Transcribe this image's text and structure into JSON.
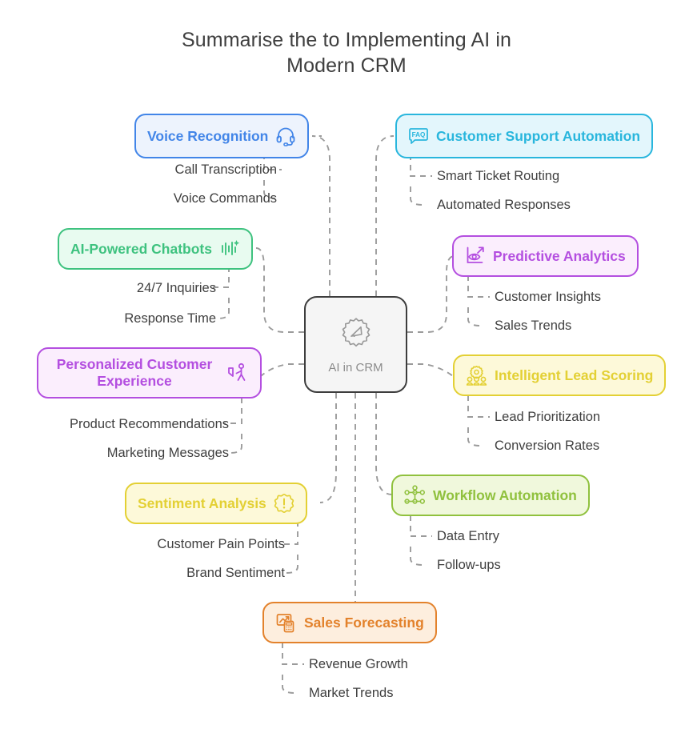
{
  "title": "Summarise the to Implementing AI in\nModern CRM",
  "title_line1": "Summarise the to Implementing AI in",
  "title_line2": "Modern CRM",
  "center": {
    "label": "AI in CRM",
    "icon": "ai-badge-icon",
    "border_color": "#3d3d3d",
    "fill_color": "#f5f5f5",
    "text_color": "#8c8c8c"
  },
  "connector": {
    "color": "#9b9b9b",
    "style": "dashed"
  },
  "branches": [
    {
      "id": "voice-recognition",
      "label": "Voice Recognition",
      "icon": "headset-icon",
      "color": "#4285e8",
      "fill": "#edf3fd",
      "side": "left",
      "children": [
        "Call Transcription",
        "Voice Commands"
      ]
    },
    {
      "id": "customer-support-automation",
      "label": "Customer Support Automation",
      "icon": "faq-bubble-icon",
      "color": "#29b6dd",
      "fill": "#e3f6fc",
      "side": "right",
      "children": [
        "Smart Ticket Routing",
        "Automated Responses"
      ]
    },
    {
      "id": "ai-powered-chatbots",
      "label": "AI-Powered Chatbots",
      "icon": "sound-wave-sparkle-icon",
      "color": "#3ec27f",
      "fill": "#e8fbf0",
      "side": "left",
      "children": [
        "24/7 Inquiries",
        "Response Time"
      ]
    },
    {
      "id": "predictive-analytics",
      "label": "Predictive Analytics",
      "icon": "eye-growth-chart-icon",
      "color": "#b44fe0",
      "fill": "#fbeefd",
      "side": "right",
      "children": [
        "Customer Insights",
        "Sales Trends"
      ]
    },
    {
      "id": "personalized-customer-experience",
      "label_line1": "Personalized Customer",
      "label_line2": "Experience",
      "label": "Personalized Customer Experience",
      "icon": "person-touch-icon",
      "color": "#b44fe0",
      "fill": "#fbeefd",
      "side": "left",
      "children": [
        "Product Recommendations",
        "Marketing Messages"
      ]
    },
    {
      "id": "intelligent-lead-scoring",
      "label": "Intelligent Lead Scoring",
      "icon": "gear-people-icon",
      "color": "#e3d034",
      "fill": "#fdf9d9",
      "side": "right",
      "children": [
        "Lead Prioritization",
        "Conversion Rates"
      ]
    },
    {
      "id": "sentiment-analysis",
      "label": "Sentiment Analysis",
      "icon": "alert-badge-icon",
      "color": "#e3d034",
      "fill": "#fdf9d9",
      "side": "left",
      "children": [
        "Customer Pain Points",
        "Brand Sentiment"
      ]
    },
    {
      "id": "workflow-automation",
      "label": "Workflow Automation",
      "icon": "node-network-icon",
      "color": "#90c13e",
      "fill": "#f0f8dc",
      "side": "right",
      "children": [
        "Data Entry",
        "Follow-ups"
      ]
    },
    {
      "id": "sales-forecasting",
      "label": "Sales Forecasting",
      "icon": "chart-calculator-icon",
      "color": "#e3822c",
      "fill": "#fdeede",
      "side": "bottom",
      "children": [
        "Revenue Growth",
        "Market Trends"
      ]
    }
  ]
}
